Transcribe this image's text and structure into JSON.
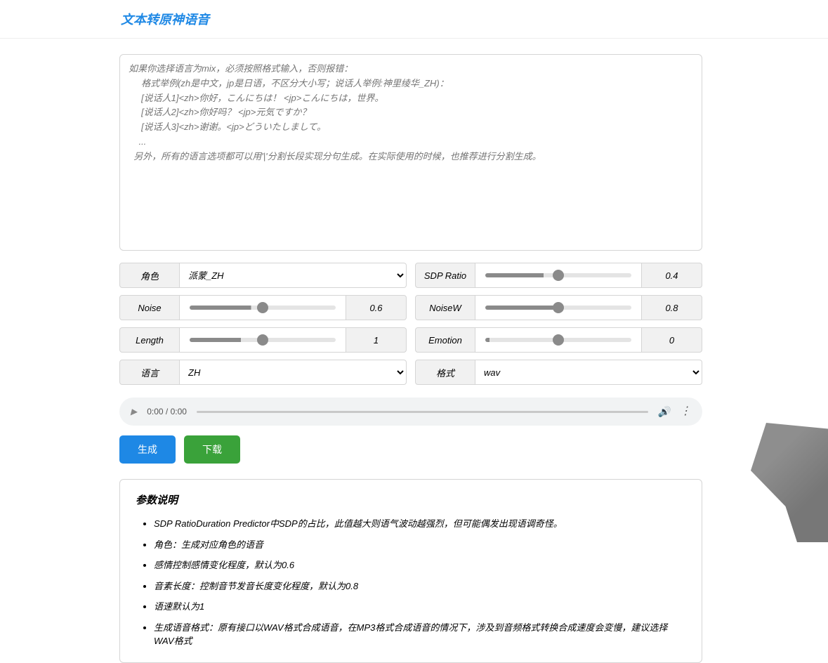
{
  "page": {
    "title": "文本转原神语音"
  },
  "textarea": {
    "placeholder": "如果你选择语言为mix，必须按照格式输入，否则报错：\n     格式举例(zh是中文，jp是日语，不区分大小写；说话人举例:神里绫华_ZH)：\n     [说话人1]<zh>你好，こんにちは！ <jp>こんにちは，世界。\n     [说话人2]<zh>你好吗？ <jp>元気ですか？\n     [说话人3]<zh>谢谢。<jp>どういたしまして。\n    ...\n  另外，所有的语言选项都可以用'|'分割长段实现分句生成。在实际使用的时候，也推荐进行分割生成。"
  },
  "controls": {
    "role": {
      "label": "角色",
      "value": "派蒙_ZH"
    },
    "sdp_ratio": {
      "label": "SDP Ratio",
      "value": "0.4",
      "percent": 40
    },
    "noise": {
      "label": "Noise",
      "value": "0.6",
      "percent": 42
    },
    "noisew": {
      "label": "NoiseW",
      "value": "0.8",
      "percent": 52
    },
    "length": {
      "label": "Length",
      "value": "1",
      "percent": 35
    },
    "emotion": {
      "label": "Emotion",
      "value": "0",
      "percent": 3
    },
    "language": {
      "label": "语言",
      "value": "ZH"
    },
    "format": {
      "label": "格式",
      "value": "wav"
    }
  },
  "audio": {
    "current": "0:00",
    "duration": "0:00"
  },
  "buttons": {
    "generate": "生成",
    "download": "下载"
  },
  "info": {
    "title": "参数说明",
    "items": [
      "SDP RatioDuration Predictor中SDP的占比，此值越大则语气波动越强烈，但可能偶发出现语调奇怪。",
      "角色：生成对应角色的语音",
      "感情控制感情变化程度，默认为0.6",
      "音素长度：控制音节发音长度变化程度，默认为0.8",
      "语速默认为1",
      "生成语音格式：原有接口以WAV格式合成语音，在MP3格式合成语音的情况下，涉及到音频格式转换合成速度会变慢，建议选择WAV格式"
    ]
  }
}
